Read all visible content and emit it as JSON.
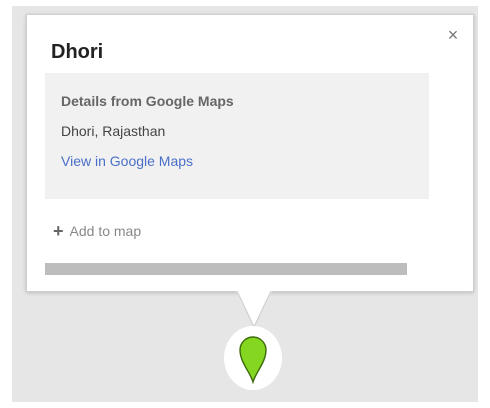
{
  "popup": {
    "title": "Dhori",
    "close_label": "×",
    "details": {
      "heading": "Details from Google Maps",
      "address": "Dhori, Rajasthan",
      "link_label": "View in Google Maps"
    },
    "add_to_map": {
      "icon": "plus-icon",
      "label": "Add to map"
    },
    "progress": {
      "fraction": 1.0
    }
  },
  "marker": {
    "icon": "map-pin-icon",
    "color": "#84d620"
  },
  "colors": {
    "link": "#4a6fc8",
    "details_background": "#f1f1f1",
    "map_background": "#e6e6e6"
  }
}
